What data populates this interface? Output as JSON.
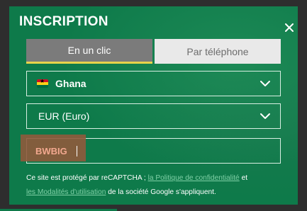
{
  "form": {
    "title": "INSCRIPTION",
    "tabs": [
      {
        "label": "En un clic",
        "active": true
      },
      {
        "label": "Par téléphone",
        "active": false
      }
    ],
    "country": {
      "value": "Ghana",
      "flag_icon": "ghana-flag-icon"
    },
    "currency": {
      "value": "EUR (Euro)"
    },
    "promo": {
      "value": "BWBIG"
    }
  },
  "legal": {
    "prefix": "Ce site est protégé par reCAPTCHA ;",
    "privacy_link": "la Politique de confidentialité",
    "connector": "et",
    "terms_link": "les Modalités d'utilisation",
    "suffix": "de la société Google s'appliquent."
  },
  "colors": {
    "panel_green": "#0e7a4a",
    "active_tab": "#7b7b7b",
    "active_tab_underline": "#e8d34a",
    "inactive_tab": "#e9e9e9",
    "promo_highlight": "#8f5a3c",
    "link": "#7fd0a6"
  }
}
